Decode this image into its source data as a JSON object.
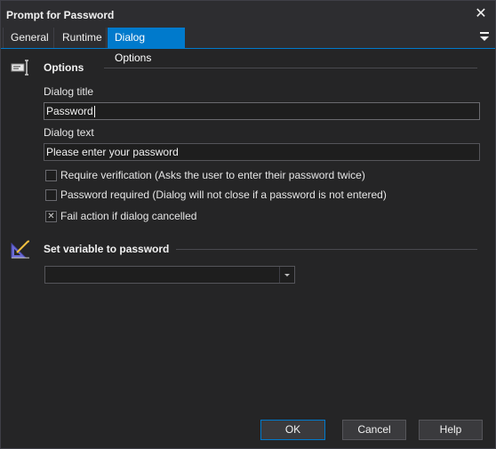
{
  "window": {
    "title": "Prompt for Password",
    "close_glyph": "✕"
  },
  "tabs": [
    {
      "label": "General",
      "active": false
    },
    {
      "label": "Runtime",
      "active": false
    },
    {
      "label": "Dialog Options",
      "active": true
    }
  ],
  "options_section": {
    "title": "Options",
    "icon": "options-icon",
    "dialog_title_label": "Dialog title",
    "dialog_title_value": "Password",
    "dialog_text_label": "Dialog text",
    "dialog_text_value": "Please enter your password",
    "checkboxes": [
      {
        "label": "Require verification (Asks the user to enter their password twice)",
        "checked": false
      },
      {
        "label": "Password required (Dialog will not close if a password is not entered)",
        "checked": false
      },
      {
        "label": "Fail action if dialog cancelled",
        "checked": true
      }
    ]
  },
  "variable_section": {
    "title": "Set variable to password",
    "icon": "set-variable-icon",
    "selected_value": ""
  },
  "buttons": {
    "ok": "OK",
    "cancel": "Cancel",
    "help": "Help"
  },
  "colors": {
    "accent": "#007acc",
    "background": "#252526",
    "titlebar": "#2d2d30"
  }
}
